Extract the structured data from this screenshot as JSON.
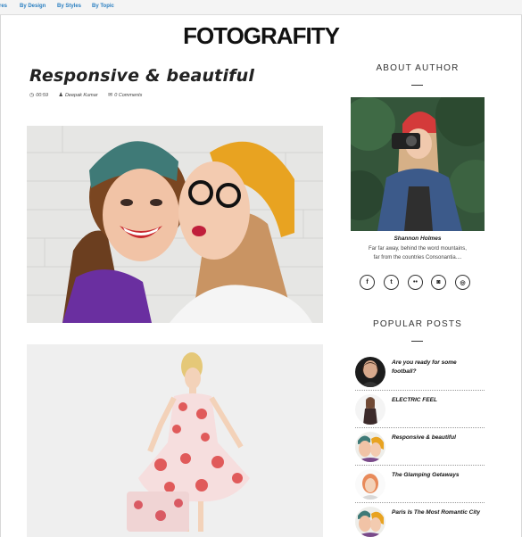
{
  "nav": {
    "items": [
      {
        "label": "res"
      },
      {
        "label": "By Design"
      },
      {
        "label": "By Styles"
      },
      {
        "label": "By Topic"
      }
    ]
  },
  "site": {
    "logo": "FOTOGRAFITY"
  },
  "post": {
    "title": "Responsive & beautiful",
    "time": "00:59",
    "author": "Deepak Kumar",
    "comments": "0 Comments"
  },
  "sidebar": {
    "about_heading": "ABOUT AUTHOR",
    "author_name": "Shannon Holmes",
    "author_bio": "Far far away, behind the word mountains, far from the countries Consonantia....",
    "social": [
      {
        "icon": "facebook-icon",
        "glyph": "f"
      },
      {
        "icon": "twitter-icon",
        "glyph": "t"
      },
      {
        "icon": "flickr-icon",
        "glyph": "••"
      },
      {
        "icon": "instagram-icon",
        "glyph": "◙"
      },
      {
        "icon": "dribbble-icon",
        "glyph": "◎"
      }
    ],
    "popular_heading": "POPULAR POSTS",
    "popular_posts": [
      {
        "title": "Are you ready for some football?"
      },
      {
        "title": "ELECTRIC FEEL"
      },
      {
        "title": "Responsive & beautiful"
      },
      {
        "title": "The Glamping Getaways"
      },
      {
        "title": "Paris Is The Most Romantic City"
      }
    ]
  }
}
